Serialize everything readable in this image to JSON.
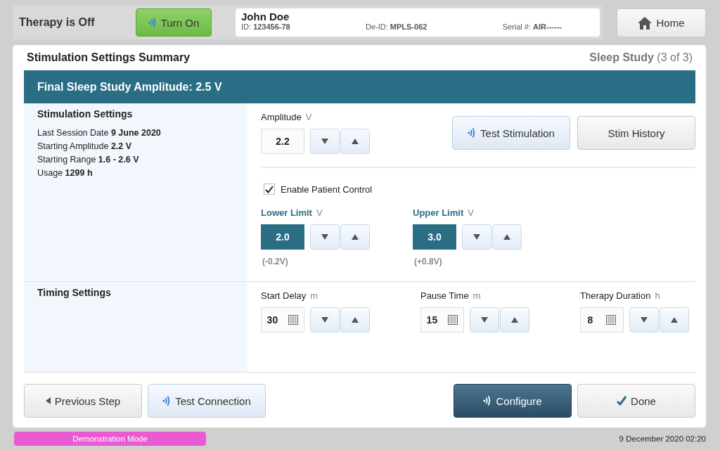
{
  "header": {
    "therapy_status": "Therapy is Off",
    "turn_on_button": {
      "label": "Turn On"
    },
    "patient": {
      "name": "John Doe",
      "fields": [
        {
          "label": "ID:",
          "value": "123456-78"
        },
        {
          "label": "De-ID:",
          "value": "MPLS-062"
        },
        {
          "label": "Serial #:",
          "value": "AIR------"
        }
      ]
    },
    "home_button": "Home"
  },
  "summary": {
    "title": "Stimulation Settings Summary",
    "step_label": "Sleep Study",
    "step_count": "(3 of 3)",
    "banner": "Final Sleep Study Amplitude: 2.5 V"
  },
  "stimulation": {
    "heading": "Stimulation Settings",
    "details": [
      {
        "label": "Last Session Date",
        "value": "9 June 2020"
      },
      {
        "label": "Starting Amplitude",
        "value": "2.2 V"
      },
      {
        "label": "Starting Range",
        "value": "1.6  -  2.6 V"
      },
      {
        "label": "Usage",
        "value": "1299 h"
      }
    ],
    "amplitude": {
      "label": "Amplitude",
      "unit": "V",
      "value": "2.2",
      "selected": false
    },
    "buttons": [
      {
        "label": "Test Stimulation",
        "kind": "wireless"
      },
      {
        "label": "Stim History",
        "kind": "plain"
      }
    ],
    "patient_control": {
      "label": "Enable Patient Control",
      "checked": true
    },
    "limits": [
      {
        "label": "Lower Limit",
        "unit": "V",
        "value": "2.0",
        "delta": "(-0.2V)",
        "selected": true
      },
      {
        "label": "Upper Limit",
        "unit": "V",
        "value": "3.0",
        "delta": "(+0.8V)",
        "selected": true
      }
    ]
  },
  "timing": {
    "heading": "Timing Settings",
    "fields": [
      {
        "label": "Start Delay",
        "unit": "m",
        "value": "30"
      },
      {
        "label": "Pause Time",
        "unit": "m",
        "value": "15"
      },
      {
        "label": "Therapy Duration",
        "unit": "h",
        "value": "8"
      }
    ]
  },
  "footer_buttons": [
    {
      "label": "Previous Step",
      "kind": "back"
    },
    {
      "label": "Test Connection",
      "kind": "wireless"
    },
    {
      "label": "Configure",
      "kind": "primary"
    },
    {
      "label": "Done",
      "kind": "confirm"
    }
  ],
  "status_bar": {
    "mode": "Demonstration Mode",
    "datetime": "9 December 2020 02:20"
  }
}
